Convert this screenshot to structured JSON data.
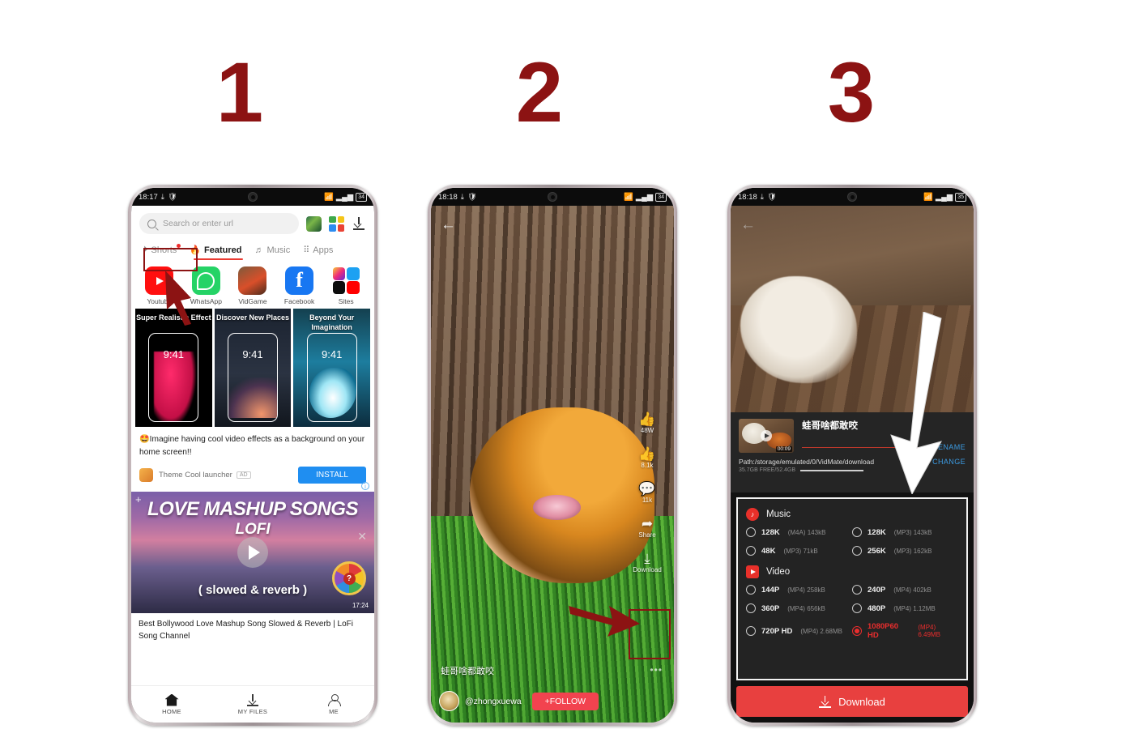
{
  "steps": [
    {
      "number": "1"
    },
    {
      "number": "2"
    },
    {
      "number": "3"
    }
  ],
  "colors": {
    "step_number": "#8c1313",
    "highlight_box": "#8c1313",
    "accent_red": "#e8403f",
    "link_blue": "#3b9ae1",
    "selected_red": "#ea2d2d",
    "install_blue": "#1f8ef1"
  },
  "phone1": {
    "status": {
      "time": "18:17",
      "battery": "34",
      "download_icon": "download-icon",
      "shield_icon": "shield-icon",
      "wifi_icon": "wifi-icon",
      "signal_icon": "signal-bars-icon"
    },
    "search": {
      "placeholder": "Search or enter url",
      "icon": "search-icon"
    },
    "toolbar_icons": [
      "game-icon",
      "apps-grid-icon",
      "downloads-icon"
    ],
    "tabs": [
      {
        "label": "Shorts",
        "icon": "shorts-icon",
        "active": false,
        "badge": true
      },
      {
        "label": "Featured",
        "icon": "flame-icon",
        "active": true
      },
      {
        "label": "Music",
        "icon": "music-note-icon",
        "active": false
      },
      {
        "label": "Apps",
        "icon": "apps-grid-icon",
        "active": false
      }
    ],
    "apps": [
      {
        "label": "Youtube",
        "icon": "youtube-icon"
      },
      {
        "label": "WhatsApp",
        "icon": "whatsapp-icon"
      },
      {
        "label": "VidGame",
        "icon": "vidgame-icon"
      },
      {
        "label": "Facebook",
        "icon": "facebook-icon"
      },
      {
        "label": "Sites",
        "icon": "sites-icon"
      }
    ],
    "promo_cards": [
      {
        "title": "Super Realistic Effect",
        "time": "9:41"
      },
      {
        "title": "Discover New Places",
        "time": "9:41"
      },
      {
        "title": "Beyond Your Imagination",
        "time": "9:41"
      }
    ],
    "ad": {
      "text": "🤩Imagine having cool video effects as a background on your home screen!!",
      "advertiser": "Theme Cool launcher",
      "badge": "AD",
      "cta": "INSTALL",
      "info_icon": "info-icon"
    },
    "video_card": {
      "title": "LOVE MASHUP SONGS",
      "subtitle": "LOFI",
      "footer": "( slowed & reverb )",
      "duration": "17:24",
      "play_icon": "play-icon",
      "close_icon": "close-icon",
      "plus_icon": "plus-icon",
      "wheel_icon": "spin-wheel-icon",
      "wheel_label": "?",
      "caption": "Best Bollywood Love Mashup Song Slowed & Reverb | LoFi Song Channel"
    },
    "nav": [
      {
        "label": "HOME",
        "icon": "home-icon",
        "active": true
      },
      {
        "label": "MY FILES",
        "icon": "download-icon",
        "active": false
      },
      {
        "label": "ME",
        "icon": "person-icon",
        "active": false
      }
    ]
  },
  "phone2": {
    "status": {
      "time": "18:18",
      "battery": "34"
    },
    "back_icon": "back-arrow-icon",
    "rail": [
      {
        "label": "48W",
        "icon": "view-count-icon"
      },
      {
        "label": "8.1k",
        "icon": "like-icon"
      },
      {
        "label": "11k",
        "icon": "comment-icon"
      },
      {
        "label": "Share",
        "icon": "share-icon"
      },
      {
        "label": "Download",
        "icon": "download-icon"
      }
    ],
    "caption": "蛙哥啥都敢咬",
    "handle": "@zhongxuewa",
    "follow_label": "+FOLLOW",
    "more_icon": "more-dots-icon"
  },
  "phone3": {
    "status": {
      "time": "18:18",
      "battery": "35"
    },
    "back_icon": "back-arrow-icon",
    "file": {
      "name": "蛙哥啥都敢咬",
      "rename_label": "RENAME",
      "path": "Path:/storage/emulated/0/VidMate/download",
      "change_label": "CHANGE",
      "storage": "35.7GB FREE/52.4GB",
      "thumb_duration": "00:09",
      "play_icon": "play-icon"
    },
    "sections": [
      {
        "title": "Music",
        "icon": "music-note-icon",
        "options": [
          {
            "quality": "128K",
            "meta": "(M4A) 143kB",
            "selected": false
          },
          {
            "quality": "128K",
            "meta": "(MP3) 143kB",
            "selected": false
          },
          {
            "quality": "48K",
            "meta": "(MP3) 71kB",
            "selected": false
          },
          {
            "quality": "256K",
            "meta": "(MP3) 162kB",
            "selected": false
          }
        ]
      },
      {
        "title": "Video",
        "icon": "video-play-icon",
        "options": [
          {
            "quality": "144P",
            "meta": "(MP4) 258kB",
            "selected": false
          },
          {
            "quality": "240P",
            "meta": "(MP4) 402kB",
            "selected": false
          },
          {
            "quality": "360P",
            "meta": "(MP4) 656kB",
            "selected": false
          },
          {
            "quality": "480P",
            "meta": "(MP4) 1.12MB",
            "selected": false
          },
          {
            "quality": "720P HD",
            "meta": "(MP4) 2.68MB",
            "selected": false
          },
          {
            "quality": "1080P60 HD",
            "meta": "(MP4) 6.49MB",
            "selected": true
          }
        ]
      }
    ],
    "download_label": "Download",
    "download_icon": "download-icon"
  }
}
